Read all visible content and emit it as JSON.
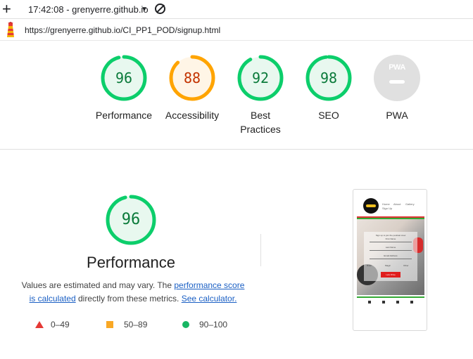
{
  "toolbar": {
    "new_tab_glyph": "+",
    "timestamp": "17:42:08 - grenyerre.github.io",
    "dropdown_glyph": "▼"
  },
  "address": {
    "url": "https://grenyerre.github.io/CI_PP1_POD/signup.html"
  },
  "colors": {
    "pass": "#0cce6b",
    "pass_text": "#0a7a3a",
    "average": "#ffa400",
    "average_text": "#c33300",
    "fail": "#e53935",
    "neutral": "#e0e0e0",
    "link": "#1a5fc4"
  },
  "scores": [
    {
      "label": "Performance",
      "value": "96",
      "fraction": 0.96,
      "rating": "pass"
    },
    {
      "label": "Accessibility",
      "value": "88",
      "fraction": 0.88,
      "rating": "average"
    },
    {
      "label": "Best Practices",
      "value": "92",
      "fraction": 0.92,
      "rating": "pass"
    },
    {
      "label": "SEO",
      "value": "98",
      "fraction": 0.98,
      "rating": "pass"
    },
    {
      "label": "PWA",
      "badge": "PWA",
      "rating": "neutral"
    }
  ],
  "performance_detail": {
    "score": "96",
    "fraction": 0.96,
    "title": "Performance",
    "desc_prefix": "Values are estimated and may vary. The ",
    "link_score": "performance score",
    "link_calc": "is calculated",
    "desc_mid": " directly from these metrics. ",
    "link_calculator": "See calculator."
  },
  "legend": [
    {
      "shape": "triangle",
      "range": "0–49"
    },
    {
      "shape": "square",
      "range": "50–89"
    },
    {
      "shape": "circle",
      "range": "90–100"
    }
  ],
  "thumbnail": {
    "nav_items": [
      "Home",
      "About",
      "Gallery",
      "Sign Up"
    ],
    "form_heading": "Sign up to join the podcast crew",
    "field_labels": [
      "First Name",
      "Last Name",
      "Email Address"
    ],
    "choice_labels": [
      "Rider",
      "Magic",
      "Other"
    ],
    "button_label": "Lets Drive"
  }
}
